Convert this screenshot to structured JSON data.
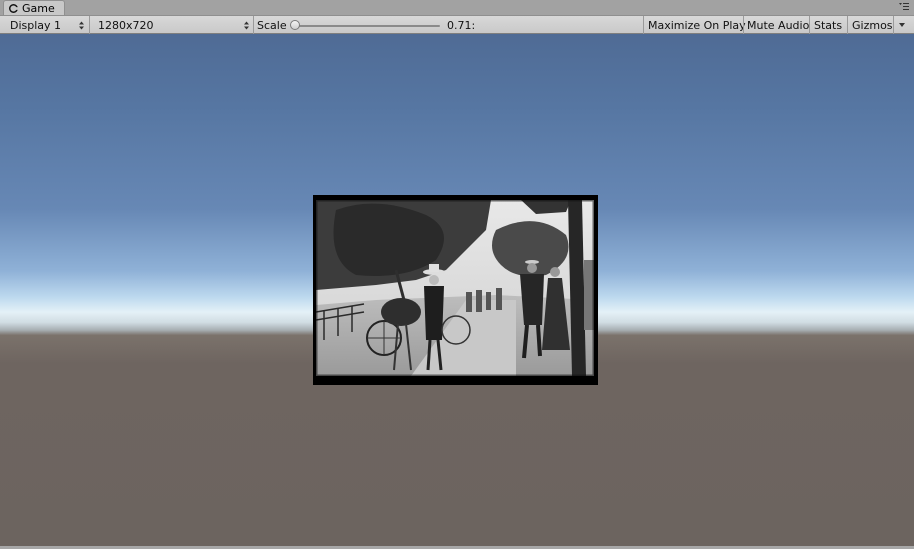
{
  "tab": {
    "label": "Game",
    "icon": "game-controller-icon"
  },
  "toolbar": {
    "display": "Display 1",
    "resolution": "1280x720",
    "scale_label": "Scale",
    "scale_value": "0.71:",
    "scale_level": 0.0,
    "maximize": "Maximize On Play",
    "mute": "Mute Audio",
    "stats": "Stats",
    "gizmos": "Gizmos"
  },
  "colors": {
    "sky_top": "#4f6b95",
    "horizon": "#e4f1f7",
    "ground": "#6c645f",
    "toolbar": "#d0d0d0"
  }
}
